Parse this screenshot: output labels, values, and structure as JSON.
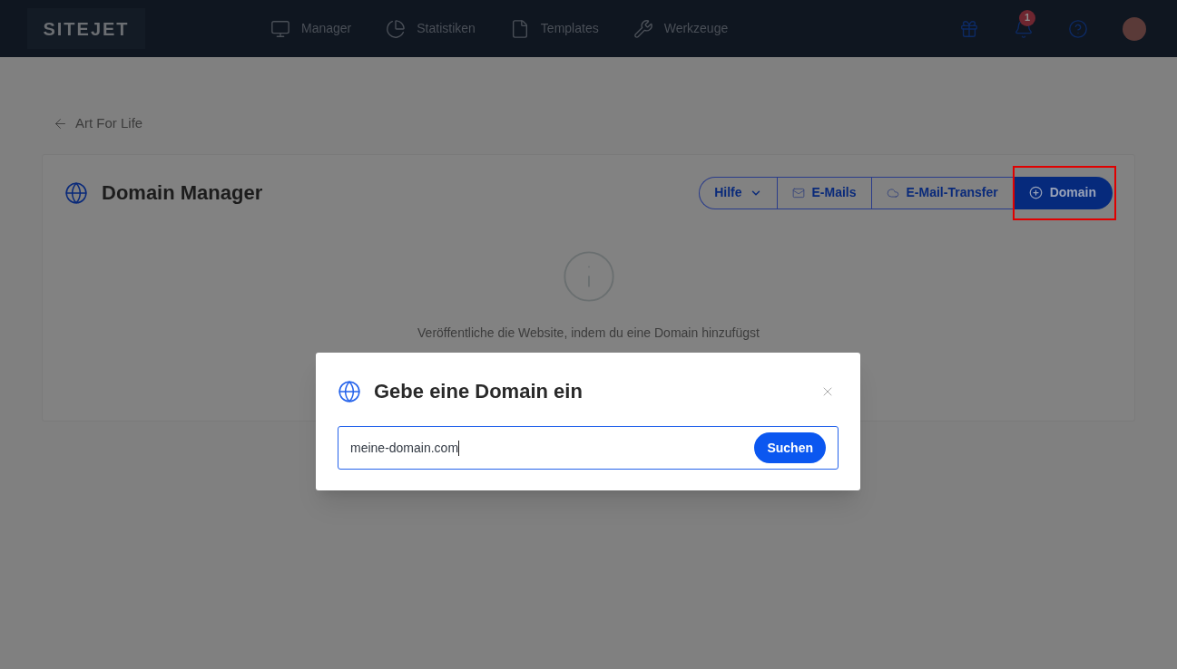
{
  "header": {
    "logo": "SITEJET",
    "nav": [
      {
        "kind": "monitor",
        "label": "Manager"
      },
      {
        "kind": "chart",
        "label": "Statistiken"
      },
      {
        "kind": "file",
        "label": "Templates"
      },
      {
        "kind": "tools",
        "label": "Werkzeuge"
      }
    ],
    "notification_count": "1"
  },
  "back_link": "Art For Life",
  "panel": {
    "title": "Domain Manager",
    "buttons": [
      {
        "kind": "dropdown",
        "label": "Hilfe"
      },
      {
        "kind": "mail",
        "label": "E-Mails"
      },
      {
        "kind": "cloud",
        "label": "E-Mail-Transfer"
      },
      {
        "kind": "primary",
        "label": "Domain",
        "highlighted": true
      }
    ],
    "empty_message": "Veröffentliche die Website, indem du eine Domain hinzufügst"
  },
  "dialog": {
    "title": "Gebe eine Domain ein",
    "input_value": "meine-domain.com",
    "search_button": "Suchen"
  }
}
